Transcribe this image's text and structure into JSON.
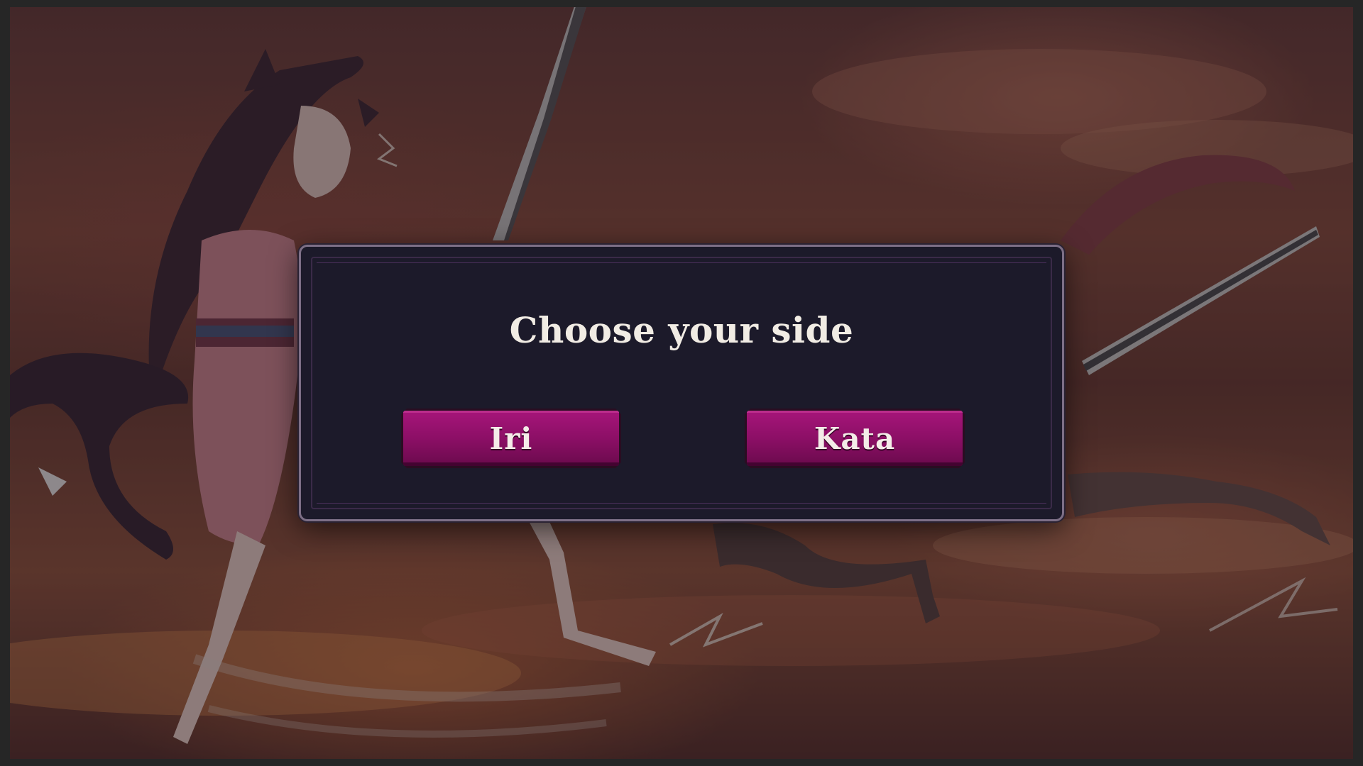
{
  "dialog": {
    "title": "Choose your side",
    "options": [
      {
        "label": "Iri"
      },
      {
        "label": "Kata"
      }
    ]
  },
  "colors": {
    "dialog_background": "#1c1a2a",
    "dialog_border": "#7d6f86",
    "button_fill": "#8c0f66",
    "title_text": "#f1ece4"
  },
  "background": {
    "description_icon": "cat-girls-sword-duel-artwork"
  }
}
